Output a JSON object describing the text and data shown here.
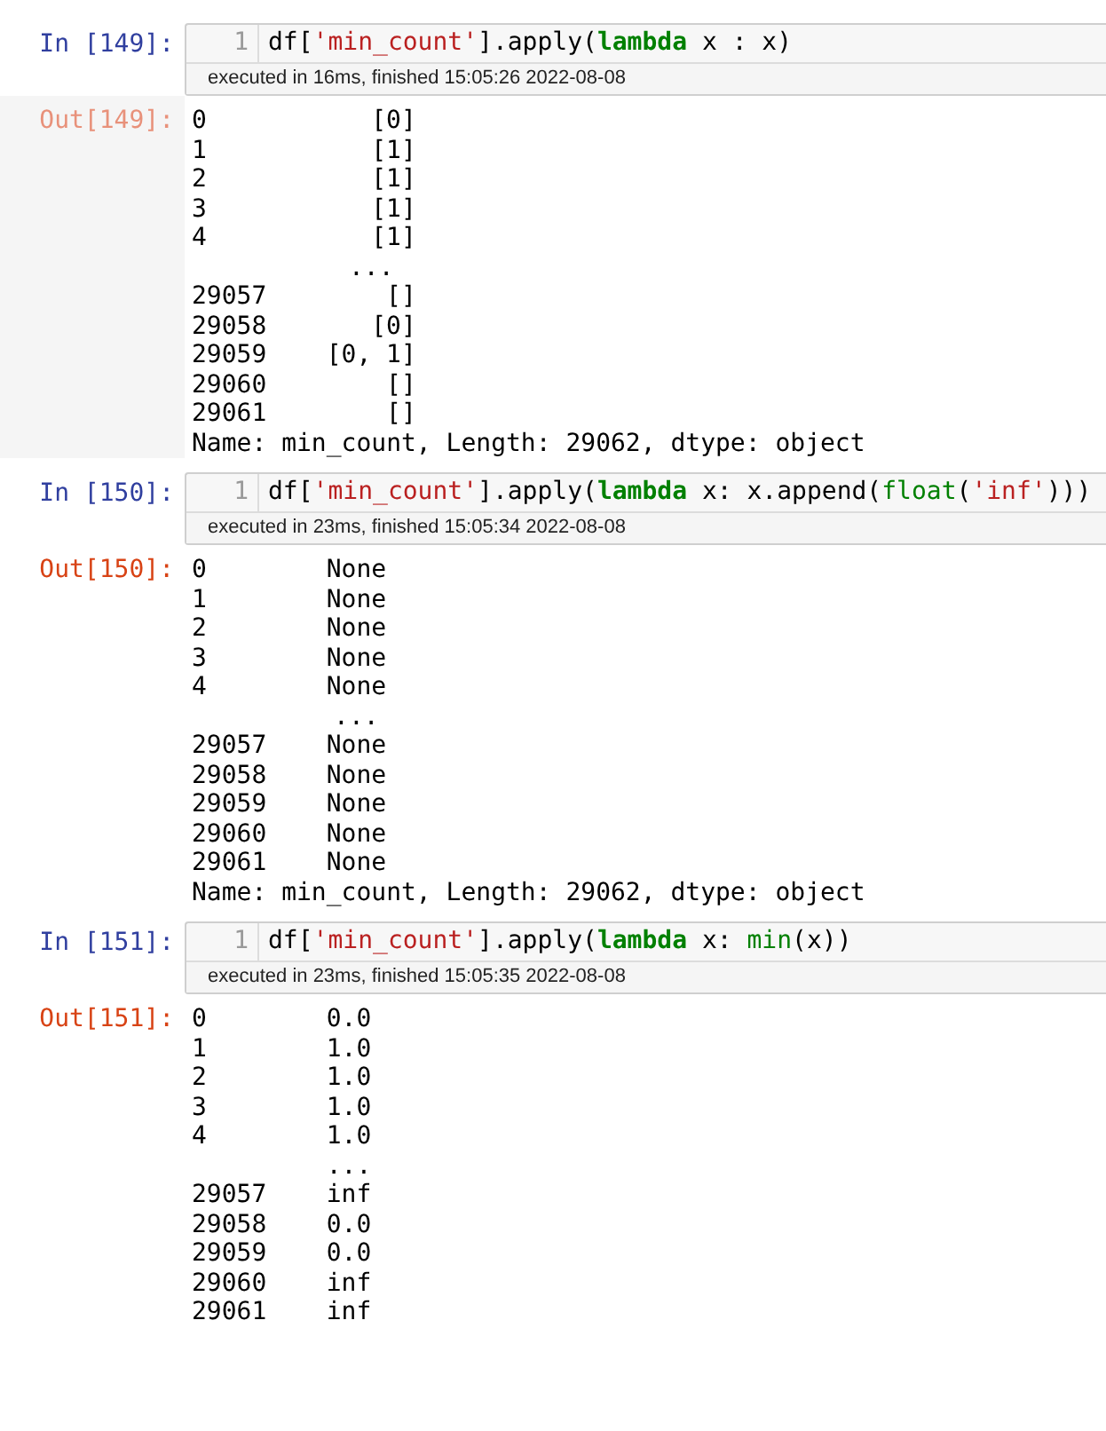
{
  "cells": [
    {
      "input": {
        "prompt": "In [149]:",
        "line_number": "1",
        "code": [
          {
            "kind": "plain",
            "text": "df["
          },
          {
            "kind": "string",
            "text": "'min_count'"
          },
          {
            "kind": "plain",
            "text": "].apply("
          },
          {
            "kind": "keyword",
            "text": "lambda"
          },
          {
            "kind": "plain",
            "text": " x : x)"
          }
        ],
        "status": "executed in 16ms, finished 15:05:26 2022-08-08"
      },
      "output": {
        "prompt": "Out[149]:",
        "highlighted": true,
        "head_rows": [
          {
            "index": "0",
            "value": "[0]"
          },
          {
            "index": "1",
            "value": "[1]"
          },
          {
            "index": "2",
            "value": "[1]"
          },
          {
            "index": "3",
            "value": "[1]"
          },
          {
            "index": "4",
            "value": "[1]"
          }
        ],
        "ellipsis": "...",
        "tail_rows": [
          {
            "index": "29057",
            "value": "[]"
          },
          {
            "index": "29058",
            "value": "[0]"
          },
          {
            "index": "29059",
            "value": "[0, 1]"
          },
          {
            "index": "29060",
            "value": "[]"
          },
          {
            "index": "29061",
            "value": "[]"
          }
        ],
        "footer": "Name: min_count, Length: 29062, dtype: object"
      }
    },
    {
      "input": {
        "prompt": "In [150]:",
        "line_number": "1",
        "code": [
          {
            "kind": "plain",
            "text": "df["
          },
          {
            "kind": "string",
            "text": "'min_count'"
          },
          {
            "kind": "plain",
            "text": "].apply("
          },
          {
            "kind": "keyword",
            "text": "lambda"
          },
          {
            "kind": "plain",
            "text": " x: x.append("
          },
          {
            "kind": "builtin",
            "text": "float"
          },
          {
            "kind": "plain",
            "text": "("
          },
          {
            "kind": "string",
            "text": "'inf'"
          },
          {
            "kind": "plain",
            "text": ")))"
          }
        ],
        "status": "executed in 23ms, finished 15:05:34 2022-08-08"
      },
      "output": {
        "prompt": "Out[150]:",
        "highlighted": false,
        "head_rows": [
          {
            "index": "0",
            "value": "None"
          },
          {
            "index": "1",
            "value": "None"
          },
          {
            "index": "2",
            "value": "None"
          },
          {
            "index": "3",
            "value": "None"
          },
          {
            "index": "4",
            "value": "None"
          }
        ],
        "ellipsis": "...",
        "tail_rows": [
          {
            "index": "29057",
            "value": "None"
          },
          {
            "index": "29058",
            "value": "None"
          },
          {
            "index": "29059",
            "value": "None"
          },
          {
            "index": "29060",
            "value": "None"
          },
          {
            "index": "29061",
            "value": "None"
          }
        ],
        "footer": "Name: min_count, Length: 29062, dtype: object"
      }
    },
    {
      "input": {
        "prompt": "In [151]:",
        "line_number": "1",
        "code": [
          {
            "kind": "plain",
            "text": "df["
          },
          {
            "kind": "string",
            "text": "'min_count'"
          },
          {
            "kind": "plain",
            "text": "].apply("
          },
          {
            "kind": "keyword",
            "text": "lambda"
          },
          {
            "kind": "plain",
            "text": " x: "
          },
          {
            "kind": "builtin",
            "text": "min"
          },
          {
            "kind": "plain",
            "text": "(x))"
          }
        ],
        "status": "executed in 23ms, finished 15:05:35 2022-08-08"
      },
      "output": {
        "prompt": "Out[151]:",
        "highlighted": false,
        "head_rows": [
          {
            "index": "0",
            "value": "0.0"
          },
          {
            "index": "1",
            "value": "1.0"
          },
          {
            "index": "2",
            "value": "1.0"
          },
          {
            "index": "3",
            "value": "1.0"
          },
          {
            "index": "4",
            "value": "1.0"
          }
        ],
        "ellipsis": "...",
        "tail_rows": [
          {
            "index": "29057",
            "value": "inf"
          },
          {
            "index": "29058",
            "value": "0.0"
          },
          {
            "index": "29059",
            "value": "0.0"
          },
          {
            "index": "29060",
            "value": "inf"
          },
          {
            "index": "29061",
            "value": "inf"
          }
        ]
      }
    }
  ]
}
